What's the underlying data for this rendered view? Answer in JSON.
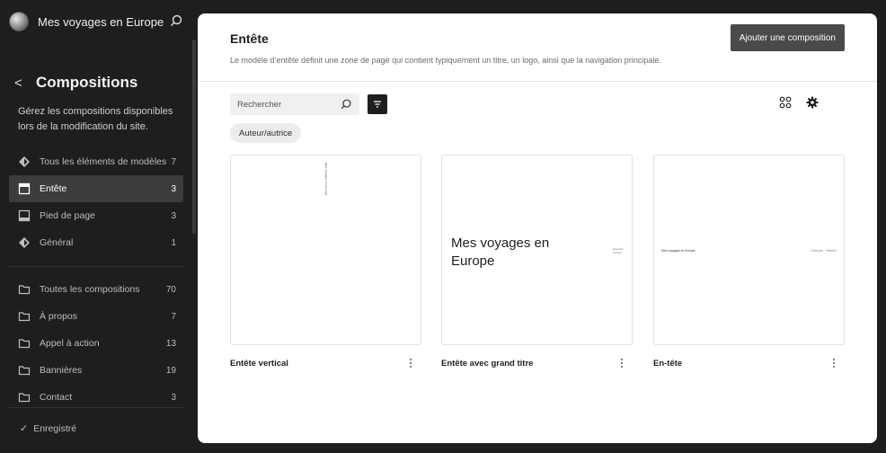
{
  "site": {
    "name": "Mes voyages en Europe"
  },
  "sidebar": {
    "back_label": "<",
    "title": "Compositions",
    "description": "Gérez les compositions disponibles lors de la modification du site.",
    "groups": [
      {
        "label": "Tous les éléments de modèles",
        "count": "7",
        "icon": "diamond-icon"
      },
      {
        "label": "Entête",
        "count": "3",
        "icon": "header-layout-icon",
        "active": true
      },
      {
        "label": "Pied de page",
        "count": "3",
        "icon": "footer-layout-icon"
      },
      {
        "label": "Général",
        "count": "1",
        "icon": "diamond-icon"
      }
    ],
    "categories": [
      {
        "label": "Toutes les compositions",
        "count": "70",
        "icon": "folder-icon"
      },
      {
        "label": "À propos",
        "count": "7",
        "icon": "folder-icon"
      },
      {
        "label": "Appel à action",
        "count": "13",
        "icon": "folder-icon"
      },
      {
        "label": "Bannières",
        "count": "19",
        "icon": "folder-icon"
      },
      {
        "label": "Contact",
        "count": "3",
        "icon": "folder-icon"
      }
    ],
    "saved_label": "Enregistré"
  },
  "main": {
    "title": "Entête",
    "description": "Le modèle d’entête définit une zone de page qui contient typiquement un titre, un logo, ainsi que la navigation principale.",
    "add_button": "Ajouter une composition",
    "search_placeholder": "Rechercher",
    "chip": "Auteur/autrice",
    "cards": [
      {
        "title": "Entête vertical",
        "preview_text": "Mes voyages en Europe"
      },
      {
        "title": "Entête avec grand titre",
        "preview_text": "Mes voyages en Europe",
        "preview_links": [
          "Exemple",
          "Histoire"
        ]
      },
      {
        "title": "En-tête",
        "preview_text": "Mes voyages en Europe",
        "preview_links": "Exemple · Histoire"
      }
    ]
  },
  "colors": {
    "sidebar_bg": "#1e1e1e",
    "active_item": "#3c3c3c",
    "button": "#4a4a4a",
    "panel": "#ffffff"
  }
}
